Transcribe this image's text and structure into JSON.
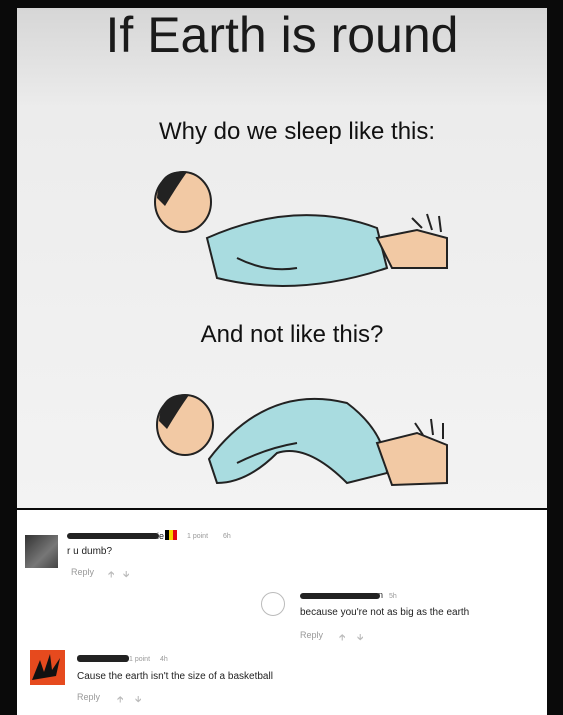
{
  "meme": {
    "title": "If Earth is round",
    "question_one": "Why do we sleep like this:",
    "question_two": "And not like this?"
  },
  "comments": [
    {
      "author_suffix": "ie",
      "points": "1 point",
      "age": "6h",
      "text": "r u dumb?",
      "reply_label": "Reply"
    },
    {
      "author_suffix": "an",
      "age": "5h",
      "text": "because you're not as big as the earth",
      "reply_label": "Reply"
    },
    {
      "points": "1 point",
      "age": "4h",
      "text": "Cause the earth isn't the size of a basketball",
      "reply_label": "Reply"
    }
  ],
  "icons": {
    "upvote": "up-arrow",
    "downvote": "down-arrow"
  }
}
